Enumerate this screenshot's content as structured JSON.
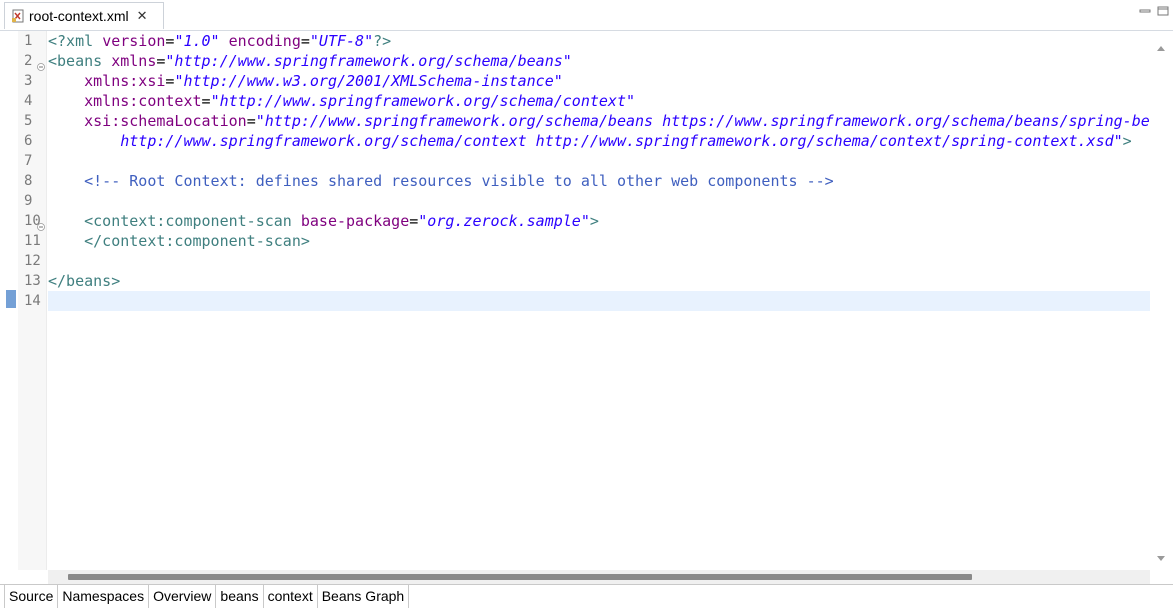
{
  "tab": {
    "title": "root-context.xml",
    "close_symbol": "✕",
    "icon": "xml-file-icon"
  },
  "window_controls": [
    "minimize-icon",
    "maximize-icon"
  ],
  "editor": {
    "line_numbers": [
      "1",
      "2",
      "3",
      "4",
      "5",
      "6",
      "7",
      "8",
      "9",
      "10",
      "11",
      "12",
      "13",
      "14"
    ],
    "folding_lines": [
      "2",
      "10"
    ],
    "current_line": "14",
    "lines": [
      [
        {
          "t": "tag",
          "s": "<?xml "
        },
        {
          "t": "attr",
          "s": "version"
        },
        {
          "t": "plain",
          "s": "="
        },
        {
          "t": "val",
          "s": "\"1.0\""
        },
        {
          "t": "plain",
          "s": " "
        },
        {
          "t": "attr",
          "s": "encoding"
        },
        {
          "t": "plain",
          "s": "="
        },
        {
          "t": "val",
          "s": "\"UTF-8\""
        },
        {
          "t": "tag",
          "s": "?>"
        }
      ],
      [
        {
          "t": "tag",
          "s": "<beans "
        },
        {
          "t": "attr",
          "s": "xmlns"
        },
        {
          "t": "plain",
          "s": "="
        },
        {
          "t": "val",
          "s": "\"http://www.springframework.org/schema/beans\""
        }
      ],
      [
        {
          "t": "plain",
          "s": "    "
        },
        {
          "t": "attr",
          "s": "xmlns:xsi"
        },
        {
          "t": "plain",
          "s": "="
        },
        {
          "t": "val",
          "s": "\"http://www.w3.org/2001/XMLSchema-instance\""
        }
      ],
      [
        {
          "t": "plain",
          "s": "    "
        },
        {
          "t": "attr",
          "s": "xmlns:context"
        },
        {
          "t": "plain",
          "s": "="
        },
        {
          "t": "val",
          "s": "\"http://www.springframework.org/schema/context\""
        }
      ],
      [
        {
          "t": "plain",
          "s": "    "
        },
        {
          "t": "attr",
          "s": "xsi:schemaLocation"
        },
        {
          "t": "plain",
          "s": "="
        },
        {
          "t": "val",
          "s": "\"http://www.springframework.org/schema/beans https://www.springframework.org/schema/beans/spring-beans.xsd"
        }
      ],
      [
        {
          "t": "val",
          "s": "        http://www.springframework.org/schema/context http://www.springframework.org/schema/context/spring-context.xsd\""
        },
        {
          "t": "tag",
          "s": ">"
        }
      ],
      [],
      [
        {
          "t": "plain",
          "s": "    "
        },
        {
          "t": "comment",
          "s": "<!-- Root Context: defines shared resources visible to all other web components -->"
        }
      ],
      [],
      [
        {
          "t": "plain",
          "s": "    "
        },
        {
          "t": "tag",
          "s": "<context:component-scan "
        },
        {
          "t": "attr",
          "s": "base-package"
        },
        {
          "t": "plain",
          "s": "="
        },
        {
          "t": "val",
          "s": "\"org.zerock.sample\""
        },
        {
          "t": "tag",
          "s": ">"
        }
      ],
      [
        {
          "t": "plain",
          "s": "    "
        },
        {
          "t": "tag",
          "s": "</context:component-scan>"
        }
      ],
      [],
      [
        {
          "t": "tag",
          "s": "</beans>"
        }
      ],
      []
    ]
  },
  "bottom_tabs": [
    "Source",
    "Namespaces",
    "Overview",
    "beans",
    "context",
    "Beans Graph"
  ],
  "active_bottom_tab": "Source",
  "colors": {
    "tag": "#3f7f7f",
    "attr": "#7f007f",
    "value": "#2a00ff",
    "comment": "#3f5fbf",
    "current_line": "#e8f2fe"
  }
}
